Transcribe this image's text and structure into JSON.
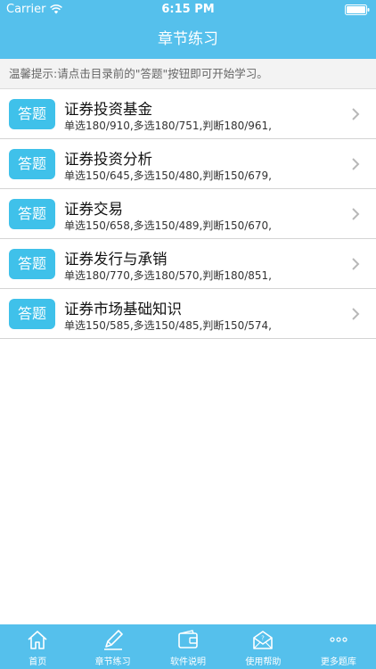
{
  "status": {
    "carrier": "Carrier",
    "time": "6:15 PM"
  },
  "nav": {
    "title": "章节练习"
  },
  "hint": "温馨提示:请点击目录前的\"答题\"按钮即可开始学习。",
  "answer_label": "答题",
  "chapters": [
    {
      "title": "证券投资基金",
      "summary": "单选180/910,多选180/751,判断180/961,"
    },
    {
      "title": "证券投资分析",
      "summary": "单选150/645,多选150/480,判断150/679,"
    },
    {
      "title": "证券交易",
      "summary": "单选150/658,多选150/489,判断150/670,"
    },
    {
      "title": "证券发行与承销",
      "summary": "单选180/770,多选180/570,判断180/851,"
    },
    {
      "title": "证券市场基础知识",
      "summary": "单选150/585,多选150/485,判断150/574,"
    }
  ],
  "tabs": [
    {
      "label": "首页",
      "icon": "home-icon"
    },
    {
      "label": "章节练习",
      "icon": "pencil-icon"
    },
    {
      "label": "软件说明",
      "icon": "wallet-icon"
    },
    {
      "label": "使用帮助",
      "icon": "help-envelope-icon"
    },
    {
      "label": "更多题库",
      "icon": "more-icon"
    }
  ],
  "colors": {
    "bar": "#55c0ec",
    "button": "#3fc1ea",
    "hint_bg": "#f3f3f3"
  }
}
